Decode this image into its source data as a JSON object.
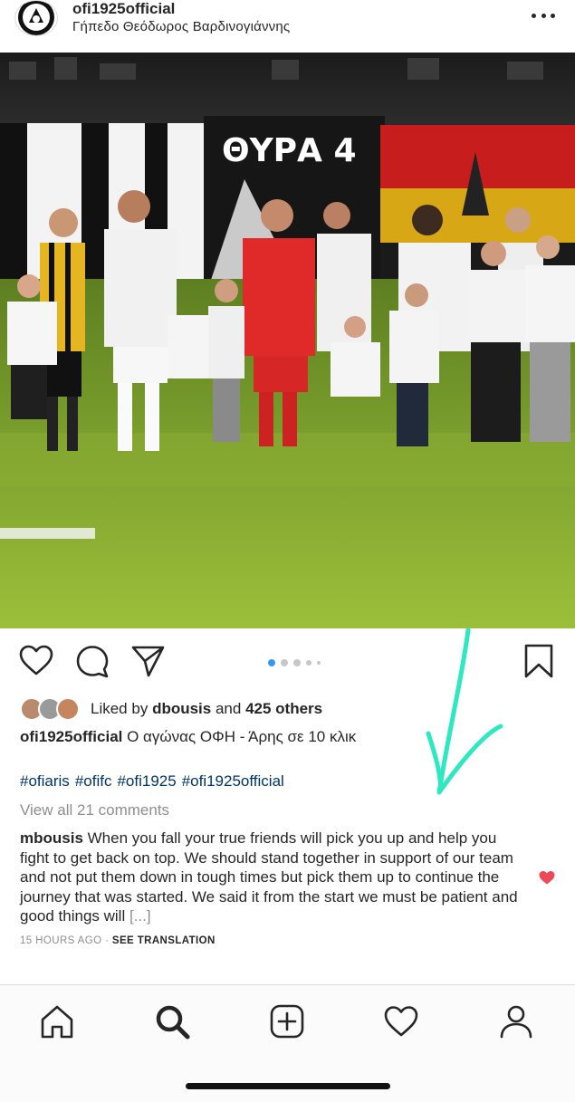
{
  "post": {
    "username": "ofi1925official",
    "location": "Γήπεδο Θεόδωρος Βαρδινογιάννης"
  },
  "photo": {
    "banner_text": "ΘΥΡΑ 4"
  },
  "carousel": {
    "current": 1,
    "total": 5
  },
  "likes": {
    "prefix": "Liked by",
    "user": "dbousis",
    "joiner": "and",
    "others": "425 others"
  },
  "caption": {
    "username": "ofi1925official",
    "text": "Ο αγώνας ΟΦΗ - Άρης σε 10 κλικ",
    "hashtags": [
      "#ofiaris",
      "#ofifc",
      "#ofi1925",
      "#ofi1925official"
    ]
  },
  "comments": {
    "view_all": "View all 21 comments",
    "items": [
      {
        "username": "mbousis",
        "text": "When you fall your true friends will pick you up and help you fight to get back on top. We should stand together in support of our team and not put them down in tough times but pick them up to continue the journey that was started. We said it from the start we must be patient and good things will",
        "more": "[...]"
      }
    ]
  },
  "meta": {
    "time": "15 HOURS AGO",
    "separator": "·",
    "translate": "SEE TRANSLATION"
  },
  "icons": {
    "header": [
      "club-logo",
      "more-options-icon"
    ],
    "actions": [
      "heart-icon",
      "comment-icon",
      "share-icon",
      "bookmark-icon"
    ],
    "tabbar": [
      "home-icon",
      "search-icon",
      "add-icon",
      "activity-icon",
      "profile-icon"
    ]
  },
  "colors": {
    "hashtag": "#003569",
    "active_dot": "#3897f0",
    "comment_heart": "#ed4956",
    "annotation_arrow": "#2de8c0"
  }
}
